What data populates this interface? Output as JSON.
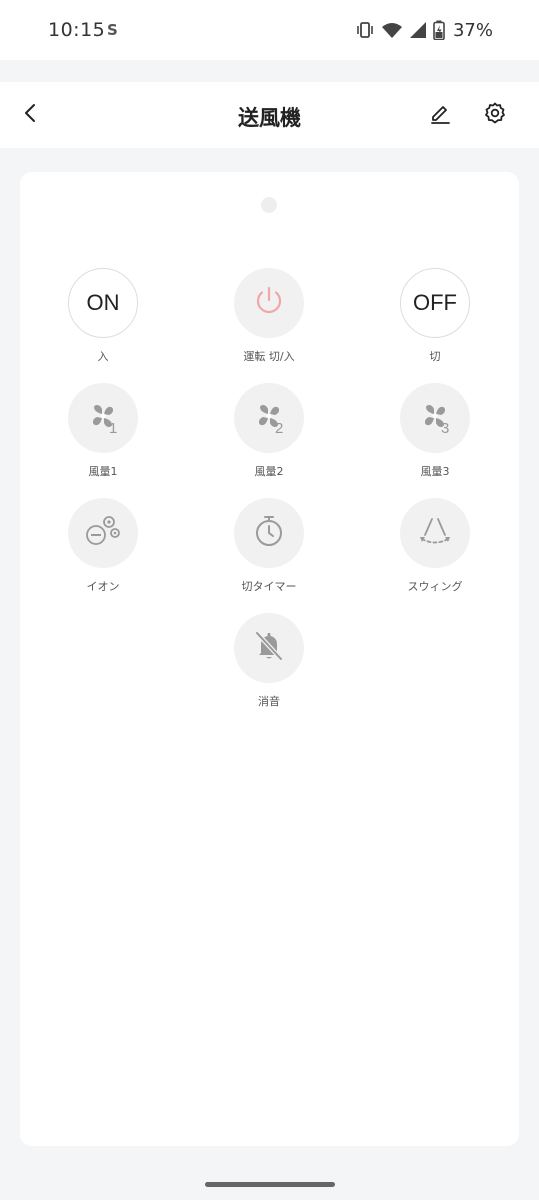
{
  "status_bar": {
    "time": "10:15",
    "app_indicator": "S",
    "battery": "37%",
    "icons": [
      "vibrate-icon",
      "wifi-icon",
      "signal-icon",
      "battery-charging-icon"
    ]
  },
  "header": {
    "title": "送風機",
    "back_icon": "back-chevron-icon",
    "edit_icon": "pencil-icon",
    "settings_icon": "gear-icon"
  },
  "keys": [
    {
      "id": "on",
      "text": "ON",
      "label": "入"
    },
    {
      "id": "power",
      "icon": "power-icon",
      "label": "運転 切/入",
      "accent": "#f2a7a7"
    },
    {
      "id": "off",
      "text": "OFF",
      "label": "切"
    },
    {
      "id": "fan1",
      "icon": "fan-icon",
      "number": "1",
      "label": "風量1"
    },
    {
      "id": "fan2",
      "icon": "fan-icon",
      "number": "2",
      "label": "風量2"
    },
    {
      "id": "fan3",
      "icon": "fan-icon",
      "number": "3",
      "label": "風量3"
    },
    {
      "id": "ion",
      "icon": "ion-icon",
      "label": "イオン"
    },
    {
      "id": "timer",
      "icon": "timer-icon",
      "label": "切タイマー"
    },
    {
      "id": "swing",
      "icon": "swing-icon",
      "label": "スウィング"
    },
    {
      "id": "mute",
      "icon": "mute-bell-icon",
      "label": "消音"
    }
  ],
  "colors": {
    "icon_gray": "#9a9a9a",
    "key_bg": "#f1f1f2",
    "power_accent": "#f2a7a7",
    "page_bg": "#f4f5f7"
  }
}
